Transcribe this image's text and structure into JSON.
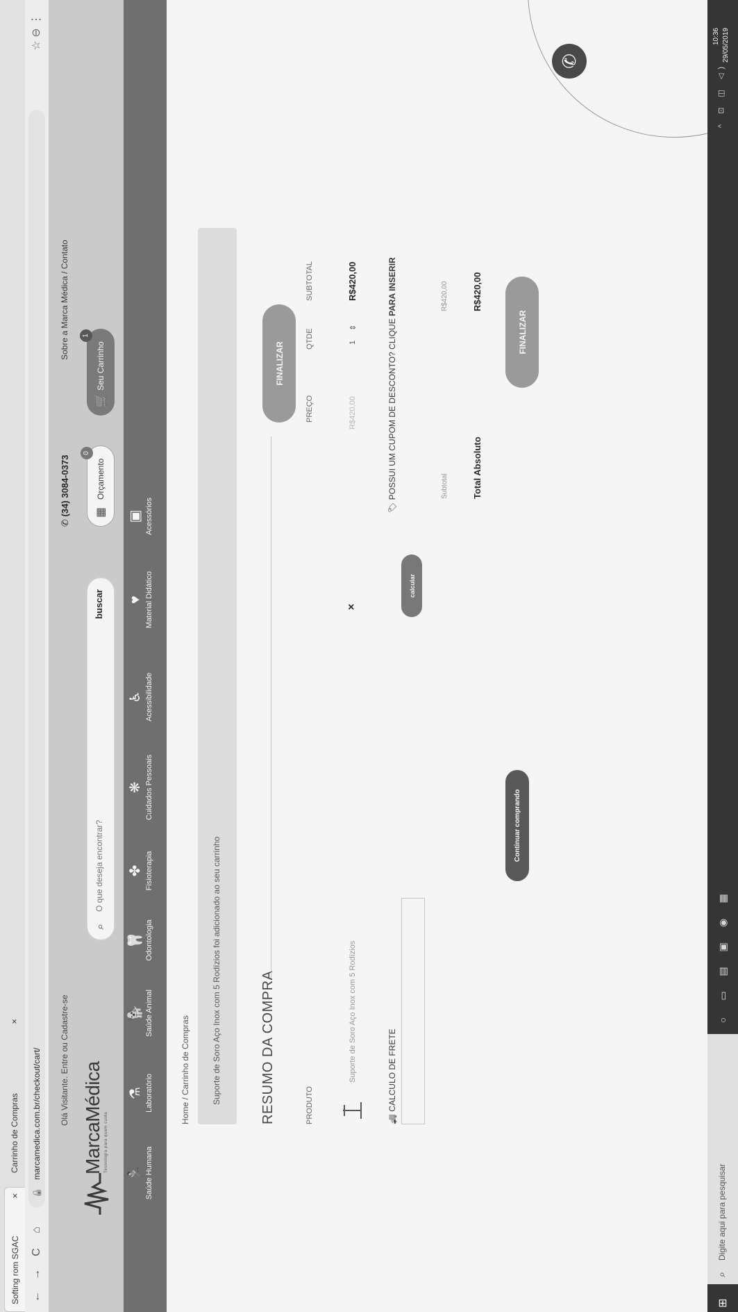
{
  "browser": {
    "tabs": [
      {
        "label": "Softing rom SGAC",
        "close": "×"
      },
      {
        "label": "Carrinho de Compras",
        "close": "×"
      }
    ],
    "url": "marcamedica.com.br/checkout/cart/",
    "nav_back": "←",
    "nav_forward": "→",
    "nav_reload": "C",
    "nav_home": "⌂"
  },
  "topbar": {
    "welcome": "Olá Visitante. Entre ou Cadastre-se",
    "phone": "(34) 3084-0373",
    "about": "Sobre a Marca Médica / Contato"
  },
  "logo": {
    "name": "MarcaMédica",
    "tagline": "Tecnologia para quem cuida"
  },
  "search": {
    "placeholder": "O que deseja encontrar?",
    "button": "buscar"
  },
  "header_buttons": {
    "orcamento": "Orçamento",
    "orcamento_count": "0",
    "carrinho": "Seu Carrinho",
    "carrinho_count": "1"
  },
  "categories": [
    {
      "label": "Saúde Humana",
      "icon": "running-person-icon",
      "glyph": "🏃"
    },
    {
      "label": "Laboratório",
      "icon": "flask-icon",
      "glyph": "⚗"
    },
    {
      "label": "Saúde Animal",
      "icon": "dog-icon",
      "glyph": "🐕"
    },
    {
      "label": "Odontologia",
      "icon": "tooth-icon",
      "glyph": "🦷"
    },
    {
      "label": "Fisioterapia",
      "icon": "physio-icon",
      "glyph": "✤"
    },
    {
      "label": "Cuidados Pessoais",
      "icon": "care-icon",
      "glyph": "❋"
    },
    {
      "label": "Acessibilidade",
      "icon": "wheelchair-icon",
      "glyph": "♿"
    },
    {
      "label": "Material Didático",
      "icon": "book-heart-icon",
      "glyph": "♥"
    },
    {
      "label": "Acessórios",
      "icon": "accessories-icon",
      "glyph": "▣"
    }
  ],
  "breadcrumb": "Home / Carrinho de Compras",
  "alert": "Suporte de Soro Aço Inox com 5 Rodízios foi adicionado ao seu carrinho",
  "summary": {
    "title": "RESUMO DA COMPRA",
    "finalizar": "FINALIZAR",
    "headers": {
      "produto": "PRODUTO",
      "preco": "PREÇO",
      "qtde": "QTDE",
      "subtotal": "SUBTOTAL"
    },
    "item": {
      "name": "Suporte de Soro Aço Inox com 5 Rodízios",
      "price": "R$420,00",
      "qty": "1",
      "qty_arrow": "⇕",
      "subtotal": "R$420,00",
      "remove": "×"
    },
    "frete_label": "CALCULO DE FRETE",
    "calcular": "calcular",
    "cupom_text": "POSSUI UM CUPOM DE DESCONTO? CLIQUE ",
    "cupom_link": "PARA INSERIR",
    "subtotal_label": "Subtotal",
    "subtotal_value": "R$420,00",
    "total_label": "Total Absoluto",
    "total_value": "R$420,00",
    "finalizar_bottom": "FINALIZAR",
    "continuar": "Continuar comprando"
  },
  "taskbar": {
    "search_placeholder": "Digite aqui para pesquisar",
    "time": "10:36",
    "date": "29/05/2019"
  },
  "colors": {
    "nav_bg": "#6e6e6e",
    "pill_bg": "#9c9c9c",
    "taskbar_bg": "#2f2f2f"
  }
}
